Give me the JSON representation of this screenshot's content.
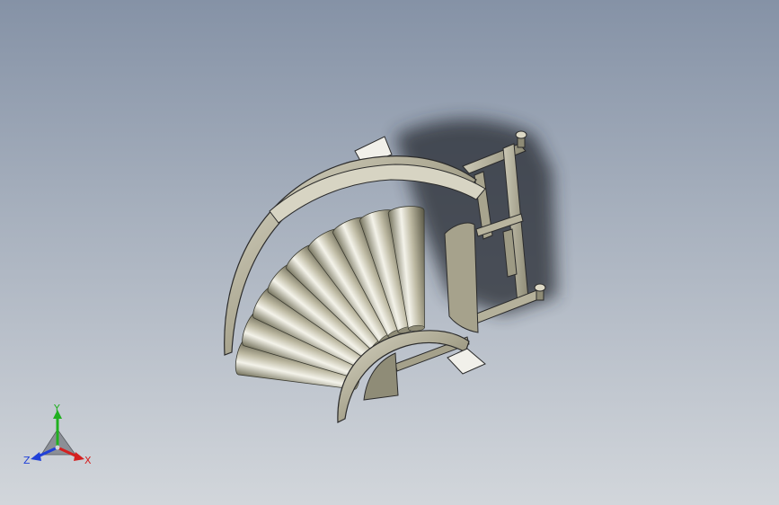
{
  "viewport": {
    "background_top": "#8592a6",
    "background_bottom": "#d2d6db"
  },
  "model": {
    "part_color": "#b8b39a",
    "edge_color": "#2b2b2b",
    "roller_count": 9
  },
  "triad": {
    "x_label": "X",
    "y_label": "Y",
    "z_label": "Z",
    "x_color": "#d42020",
    "y_color": "#20b020",
    "z_color": "#2040d8"
  }
}
